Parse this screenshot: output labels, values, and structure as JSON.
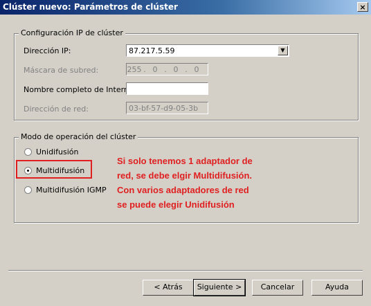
{
  "window": {
    "title": "Clúster nuevo:  Parámetros de clúster",
    "close_label": "×"
  },
  "ip_config": {
    "legend": "Configuración IP de clúster",
    "ip_label": "Dirección IP:",
    "ip_value": "87.217.5.59",
    "mask_label": "Máscara de subred:",
    "mask_parts": [
      "255",
      "0",
      "0",
      "0"
    ],
    "fqdn_label": "Nombre completo de Internet:",
    "fqdn_value": "",
    "mac_label": "Dirección de red:",
    "mac_value": "03-bf-57-d9-05-3b"
  },
  "operation_mode": {
    "legend": "Modo de operación del clúster",
    "options": [
      {
        "label": "Unidifusión",
        "checked": false
      },
      {
        "label": "Multidifusión",
        "checked": true
      },
      {
        "label": "Multidifusión IGMP",
        "checked": false
      }
    ]
  },
  "annotation": {
    "lines": [
      "Si solo tenemos 1 adaptador de",
      "red, se debe elgir Multidifusión.",
      "Con varios adaptadores de red",
      "se puede elegir Unidifusión"
    ],
    "color": "#e02020"
  },
  "buttons": {
    "back": "< Atrás",
    "next": "Siguiente >",
    "cancel": "Cancelar",
    "help": "Ayuda"
  }
}
